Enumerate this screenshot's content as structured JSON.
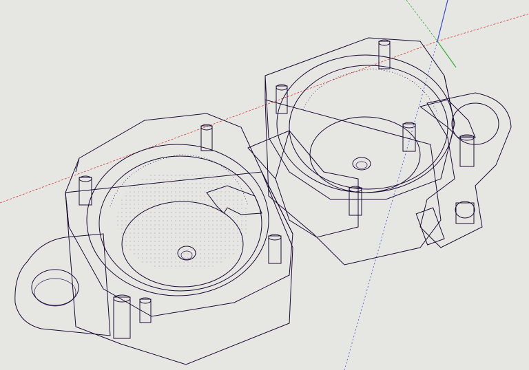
{
  "viewport": {
    "background_color": "#e6e6e3",
    "model_color": "#6b2fb8",
    "model_color_dark": "#4a1c8a",
    "model_color_light": "#8a4fd6",
    "edge_color": "#1b0a33"
  },
  "axes": {
    "red_axis_color": "#d23a3a",
    "green_axis_color": "#3aa83a",
    "blue_axis_color": "#3a4ad2"
  }
}
